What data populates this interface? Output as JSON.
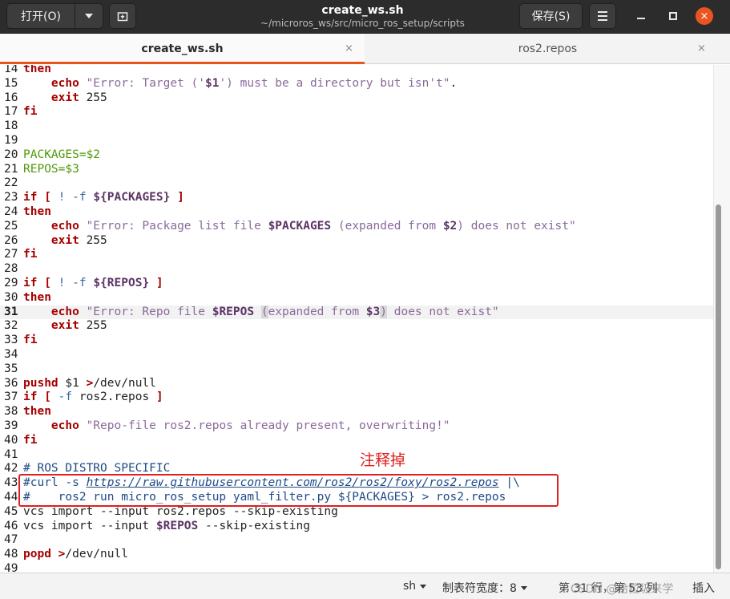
{
  "header": {
    "open_label": "打开(O)",
    "title": "create_ws.sh",
    "subtitle": "~/microros_ws/src/micro_ros_setup/scripts",
    "save_label": "保存(S)",
    "close_glyph": "×"
  },
  "tabs": [
    {
      "label": "create_ws.sh",
      "active": true
    },
    {
      "label": "ros2.repos",
      "active": false
    }
  ],
  "tab_close_glyph": "×",
  "lines": [
    {
      "n": "14",
      "tokens": [
        {
          "t": "then",
          "c": "kw"
        }
      ]
    },
    {
      "n": "15",
      "tokens": [
        {
          "t": "    "
        },
        {
          "t": "echo",
          "c": "kw"
        },
        {
          "t": " "
        },
        {
          "t": "\"Error: Target ('",
          "c": "strg"
        },
        {
          "t": "$1",
          "c": "vb"
        },
        {
          "t": "') must be a directory but isn't\"",
          "c": "strg"
        },
        {
          "t": "."
        }
      ]
    },
    {
      "n": "16",
      "tokens": [
        {
          "t": "    "
        },
        {
          "t": "exit",
          "c": "kw"
        },
        {
          "t": " 255"
        }
      ]
    },
    {
      "n": "17",
      "tokens": [
        {
          "t": "fi",
          "c": "kw"
        }
      ]
    },
    {
      "n": "18",
      "tokens": []
    },
    {
      "n": "19",
      "tokens": []
    },
    {
      "n": "20",
      "tokens": [
        {
          "t": "PACKAGES",
          "c": "var"
        },
        {
          "t": "=$2",
          "c": "var"
        }
      ]
    },
    {
      "n": "21",
      "tokens": [
        {
          "t": "REPOS",
          "c": "var"
        },
        {
          "t": "=$3",
          "c": "var"
        }
      ]
    },
    {
      "n": "22",
      "tokens": []
    },
    {
      "n": "23",
      "tokens": [
        {
          "t": "if",
          "c": "kw"
        },
        {
          "t": " "
        },
        {
          "t": "[",
          "c": "kw"
        },
        {
          "t": " "
        },
        {
          "t": "! -f",
          "c": "op"
        },
        {
          "t": " "
        },
        {
          "t": "${",
          "c": "vb"
        },
        {
          "t": "PACKAGES",
          "c": "vb"
        },
        {
          "t": "}",
          "c": "vb"
        },
        {
          "t": " "
        },
        {
          "t": "]",
          "c": "kw"
        }
      ]
    },
    {
      "n": "24",
      "tokens": [
        {
          "t": "then",
          "c": "kw"
        }
      ]
    },
    {
      "n": "25",
      "tokens": [
        {
          "t": "    "
        },
        {
          "t": "echo",
          "c": "kw"
        },
        {
          "t": " "
        },
        {
          "t": "\"Error: Package list file ",
          "c": "strg"
        },
        {
          "t": "$PACKAGES",
          "c": "vb"
        },
        {
          "t": " (expanded from ",
          "c": "strg"
        },
        {
          "t": "$2",
          "c": "vb"
        },
        {
          "t": ") does not exist\"",
          "c": "strg"
        }
      ]
    },
    {
      "n": "26",
      "tokens": [
        {
          "t": "    "
        },
        {
          "t": "exit",
          "c": "kw"
        },
        {
          "t": " 255"
        }
      ]
    },
    {
      "n": "27",
      "tokens": [
        {
          "t": "fi",
          "c": "kw"
        }
      ]
    },
    {
      "n": "28",
      "tokens": []
    },
    {
      "n": "29",
      "tokens": [
        {
          "t": "if",
          "c": "kw"
        },
        {
          "t": " "
        },
        {
          "t": "[",
          "c": "kw"
        },
        {
          "t": " "
        },
        {
          "t": "! -f",
          "c": "op"
        },
        {
          "t": " "
        },
        {
          "t": "${",
          "c": "vb"
        },
        {
          "t": "REPOS",
          "c": "vb"
        },
        {
          "t": "}",
          "c": "vb"
        },
        {
          "t": " "
        },
        {
          "t": "]",
          "c": "kw"
        }
      ]
    },
    {
      "n": "30",
      "tokens": [
        {
          "t": "then",
          "c": "kw"
        }
      ]
    },
    {
      "n": "31",
      "current": true,
      "tokens": [
        {
          "t": "    "
        },
        {
          "t": "echo",
          "c": "kw"
        },
        {
          "t": " "
        },
        {
          "t": "\"Error: Repo file ",
          "c": "strg"
        },
        {
          "t": "$REPOS",
          "c": "vb"
        },
        {
          "t": " "
        },
        {
          "t": "(",
          "c": "strg bracket-hl"
        },
        {
          "t": "expanded from ",
          "c": "strg"
        },
        {
          "t": "$3",
          "c": "vb"
        },
        {
          "t": ")",
          "c": "strg bracket-hl"
        },
        {
          "t": " does not exist\"",
          "c": "strg"
        }
      ]
    },
    {
      "n": "32",
      "tokens": [
        {
          "t": "    "
        },
        {
          "t": "exit",
          "c": "kw"
        },
        {
          "t": " 255"
        }
      ]
    },
    {
      "n": "33",
      "tokens": [
        {
          "t": "fi",
          "c": "kw"
        }
      ]
    },
    {
      "n": "34",
      "tokens": []
    },
    {
      "n": "35",
      "tokens": []
    },
    {
      "n": "36",
      "tokens": [
        {
          "t": "pushd",
          "c": "kw"
        },
        {
          "t": " $1 "
        },
        {
          "t": ">",
          "c": "kw"
        },
        {
          "t": "/dev/null"
        }
      ]
    },
    {
      "n": "37",
      "tokens": [
        {
          "t": "if",
          "c": "kw"
        },
        {
          "t": " "
        },
        {
          "t": "[",
          "c": "kw"
        },
        {
          "t": " "
        },
        {
          "t": "-f",
          "c": "op"
        },
        {
          "t": " ros2.repos "
        },
        {
          "t": "]",
          "c": "kw"
        }
      ]
    },
    {
      "n": "38",
      "tokens": [
        {
          "t": "then",
          "c": "kw"
        }
      ]
    },
    {
      "n": "39",
      "tokens": [
        {
          "t": "    "
        },
        {
          "t": "echo",
          "c": "kw"
        },
        {
          "t": " "
        },
        {
          "t": "\"Repo-file ros2.repos already present, overwriting!\"",
          "c": "strg"
        }
      ]
    },
    {
      "n": "40",
      "tokens": [
        {
          "t": "fi",
          "c": "kw"
        }
      ]
    },
    {
      "n": "41",
      "tokens": []
    },
    {
      "n": "42",
      "tokens": [
        {
          "t": "# ROS DISTRO SPECIFIC",
          "c": "cmt"
        }
      ]
    },
    {
      "n": "43",
      "tokens": [
        {
          "t": "#curl -s ",
          "c": "cmt"
        },
        {
          "t": "https://raw.githubusercontent.com/ros2/ros2/foxy/ros2.repos",
          "c": "cmti"
        },
        {
          "t": " |\\",
          "c": "cmt"
        }
      ]
    },
    {
      "n": "44",
      "tokens": [
        {
          "t": "#    ros2 run micro_ros_setup yaml_filter.py ${PACKAGES} > ros2.repos",
          "c": "cmt"
        }
      ]
    },
    {
      "n": "45",
      "tokens": [
        {
          "t": "vcs import --input ros2.repos --skip-existing"
        }
      ]
    },
    {
      "n": "46",
      "tokens": [
        {
          "t": "vcs import --input "
        },
        {
          "t": "$REPOS",
          "c": "vb"
        },
        {
          "t": " --skip-existing"
        }
      ]
    },
    {
      "n": "47",
      "tokens": []
    },
    {
      "n": "48",
      "tokens": [
        {
          "t": "popd",
          "c": "kw"
        },
        {
          "t": " "
        },
        {
          "t": ">",
          "c": "kw"
        },
        {
          "t": "/dev/null"
        }
      ]
    },
    {
      "n": "49",
      "tokens": []
    }
  ],
  "annotation": {
    "text": "注释掉"
  },
  "statusbar": {
    "language": "sh",
    "tab_width": "制表符宽度：8",
    "position": "第 31 行，第 53 列",
    "mode": "插入",
    "watermark": "CSDN @拾拉圾来学"
  }
}
